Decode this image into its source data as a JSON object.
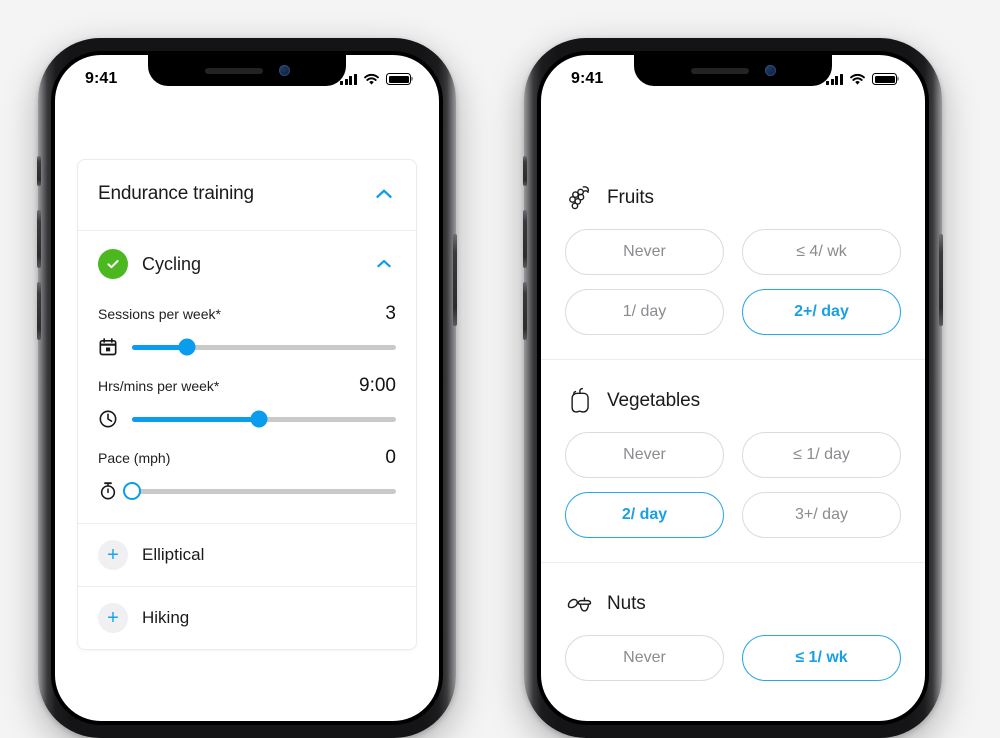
{
  "theme": {
    "accent": "#0a9ced",
    "accent_border": "#29a8e8",
    "success": "#4cb820",
    "track": "#c9c9c9",
    "muted_text": "#8b8b90",
    "page_background": "#f4f4f4"
  },
  "phones": [
    {
      "id": "exercise-phone",
      "status_bar": {
        "time": "9:41",
        "signal_icon": "signal-bars-icon",
        "wifi_icon": "wifi-icon",
        "battery_icon": "battery-full-icon"
      },
      "card": {
        "title": "Endurance training",
        "collapse_icon": "chevron-up-icon",
        "activity": {
          "name": "Cycling",
          "status_icon": "check-circle-icon",
          "collapse_icon": "chevron-up-icon",
          "sliders": [
            {
              "label": "Sessions per week*",
              "value": "3",
              "icon": "calendar-icon",
              "percent": 21,
              "thumb_style": "filled"
            },
            {
              "label": "Hrs/mins per week*",
              "value": "9:00",
              "icon": "clock-icon",
              "percent": 48,
              "thumb_style": "filled"
            },
            {
              "label": "Pace (mph)",
              "value": "0",
              "icon": "stopwatch-icon",
              "percent": 0,
              "thumb_style": "hollow"
            }
          ]
        },
        "more_activities": [
          {
            "name": "Elliptical",
            "icon": "plus-icon"
          },
          {
            "name": "Hiking",
            "icon": "plus-icon"
          }
        ]
      }
    },
    {
      "id": "nutrition-phone",
      "status_bar": {
        "time": "9:41",
        "signal_icon": "signal-bars-icon",
        "wifi_icon": "wifi-icon",
        "battery_icon": "battery-full-icon"
      },
      "sections": [
        {
          "title": "Fruits",
          "icon": "grapes-icon",
          "options": [
            {
              "label": "Never",
              "selected": false
            },
            {
              "label": "≤ 4/ wk",
              "selected": false
            },
            {
              "label": "1/ day",
              "selected": false
            },
            {
              "label": "2+/ day",
              "selected": true
            }
          ]
        },
        {
          "title": "Vegetables",
          "icon": "pepper-icon",
          "options": [
            {
              "label": "Never",
              "selected": false
            },
            {
              "label": "≤ 1/ day",
              "selected": false
            },
            {
              "label": "2/ day",
              "selected": true
            },
            {
              "label": "3+/ day",
              "selected": false
            }
          ]
        },
        {
          "title": "Nuts",
          "icon": "acorn-icon",
          "options": [
            {
              "label": "Never",
              "selected": false
            },
            {
              "label": "≤ 1/ wk",
              "selected": true
            }
          ]
        }
      ]
    }
  ]
}
